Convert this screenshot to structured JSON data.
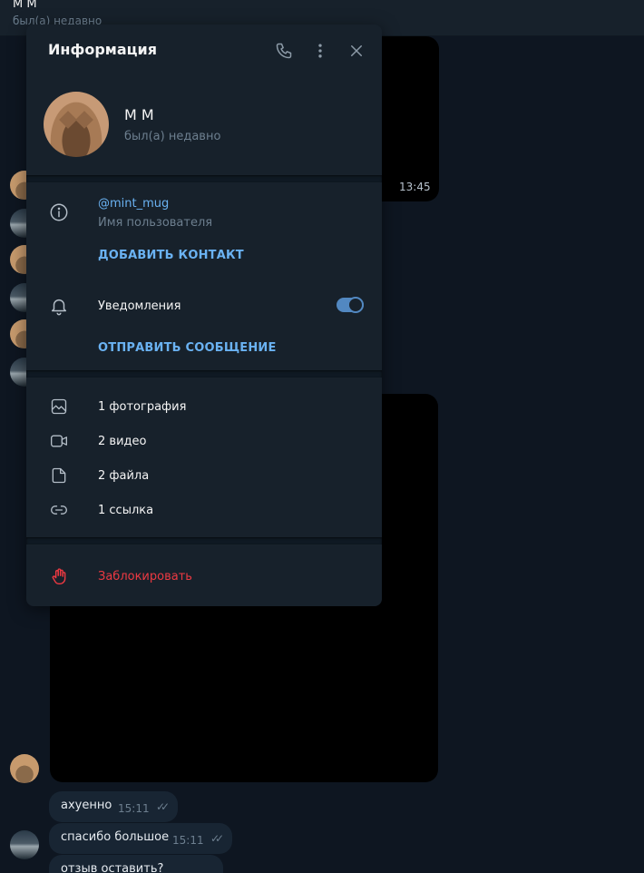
{
  "chat": {
    "name": "М М",
    "status": "был(а) недавно",
    "top_message_time": "13:45",
    "messages": [
      {
        "text": "ахуенно",
        "time": "15:11",
        "checks": "✓✓"
      },
      {
        "text": "спасибо большое",
        "time": "15:11",
        "checks": "✓✓"
      },
      {
        "text": "отзыв оставить?"
      }
    ]
  },
  "panel": {
    "title": "Информация",
    "header_icons": [
      "phone-icon",
      "more-vertical-icon",
      "close-icon"
    ],
    "profile": {
      "name": "М М",
      "status": "был(а) недавно"
    },
    "info": {
      "username": "@mint_mug",
      "username_label": "Имя пользователя",
      "add_contact": "ДОБАВИТЬ КОНТАКТ",
      "notifications_label": "Уведомления",
      "notifications_enabled": true,
      "send_message": "ОТПРАВИТЬ СООБЩЕНИЕ"
    },
    "media": [
      {
        "icon": "photo-icon",
        "label": "1 фотография"
      },
      {
        "icon": "video-icon",
        "label": "2 видео"
      },
      {
        "icon": "file-icon",
        "label": "2 файла"
      },
      {
        "icon": "link-icon",
        "label": "1 ссылка"
      }
    ],
    "block": {
      "icon": "hand-icon",
      "label": "Заблокировать"
    }
  },
  "colors": {
    "background": "#0e1621",
    "panel": "#17212b",
    "accent": "#6ab2f2",
    "toggle": "#5288c1",
    "danger": "#ec3942",
    "muted": "#6d7f8f"
  }
}
